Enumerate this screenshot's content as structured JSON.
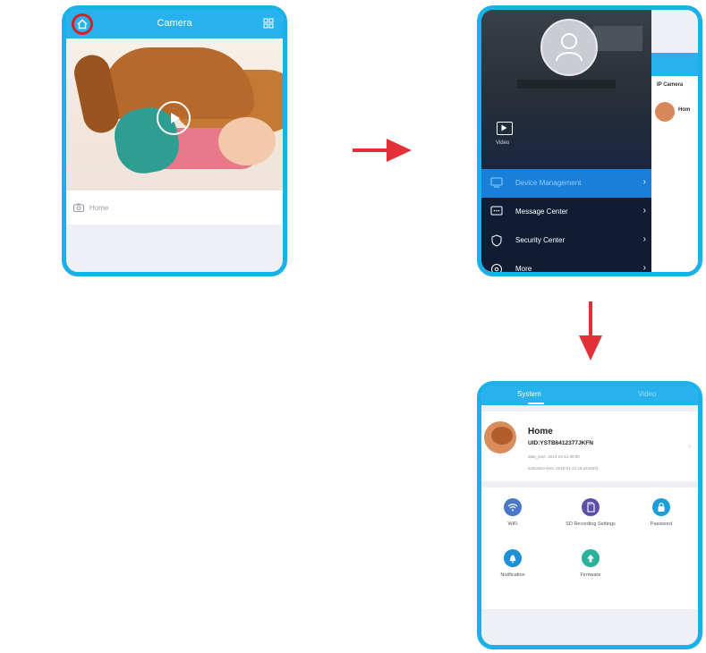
{
  "screen1": {
    "title": "Camera",
    "caption": "Home",
    "icons": {
      "home": "home-icon",
      "grid": "grid-icon",
      "play": "play-icon",
      "camera": "camera-icon"
    },
    "colors": {
      "header": "#27b2ee",
      "highlight_ring": "#d81f26",
      "frame": "#1ab0e8"
    }
  },
  "screen2": {
    "video_label": "Video",
    "menu": [
      {
        "label": "Device Management",
        "icon": "device-icon",
        "active": true
      },
      {
        "label": "Message Center",
        "icon": "message-icon",
        "active": false
      },
      {
        "label": "Security Center",
        "icon": "shield-icon",
        "active": false
      },
      {
        "label": "More",
        "icon": "more-icon",
        "active": false
      }
    ],
    "side_panel": {
      "title": "IP Camera",
      "device_name": "Hom"
    },
    "colors": {
      "menu_bg": "#101c34",
      "active_item": "#1a7fd8"
    }
  },
  "screen3": {
    "tabs": [
      {
        "label": "System",
        "active": true
      },
      {
        "label": "Video",
        "active": false
      }
    ],
    "device": {
      "name": "Home",
      "uid": "UID:YSTB6412377JKFN",
      "line1": "date_time: 2013-03-14 00:00",
      "line2": "activation time: 2018-01-21 16:44:50(s)"
    },
    "functions": [
      {
        "label": "WiFi",
        "icon": "wifi-icon",
        "color": "#4a78c8"
      },
      {
        "label": "SD Recording Settings",
        "icon": "sd-card-icon",
        "color": "#5b4fa8"
      },
      {
        "label": "Password",
        "icon": "lock-icon",
        "color": "#1a9fd8"
      },
      {
        "label": "Notification",
        "icon": "bell-icon",
        "color": "#1f8fd8"
      },
      {
        "label": "Firmware",
        "icon": "upgrade-icon",
        "color": "#2bb09a"
      }
    ]
  },
  "arrows": {
    "color": "#e23036"
  }
}
